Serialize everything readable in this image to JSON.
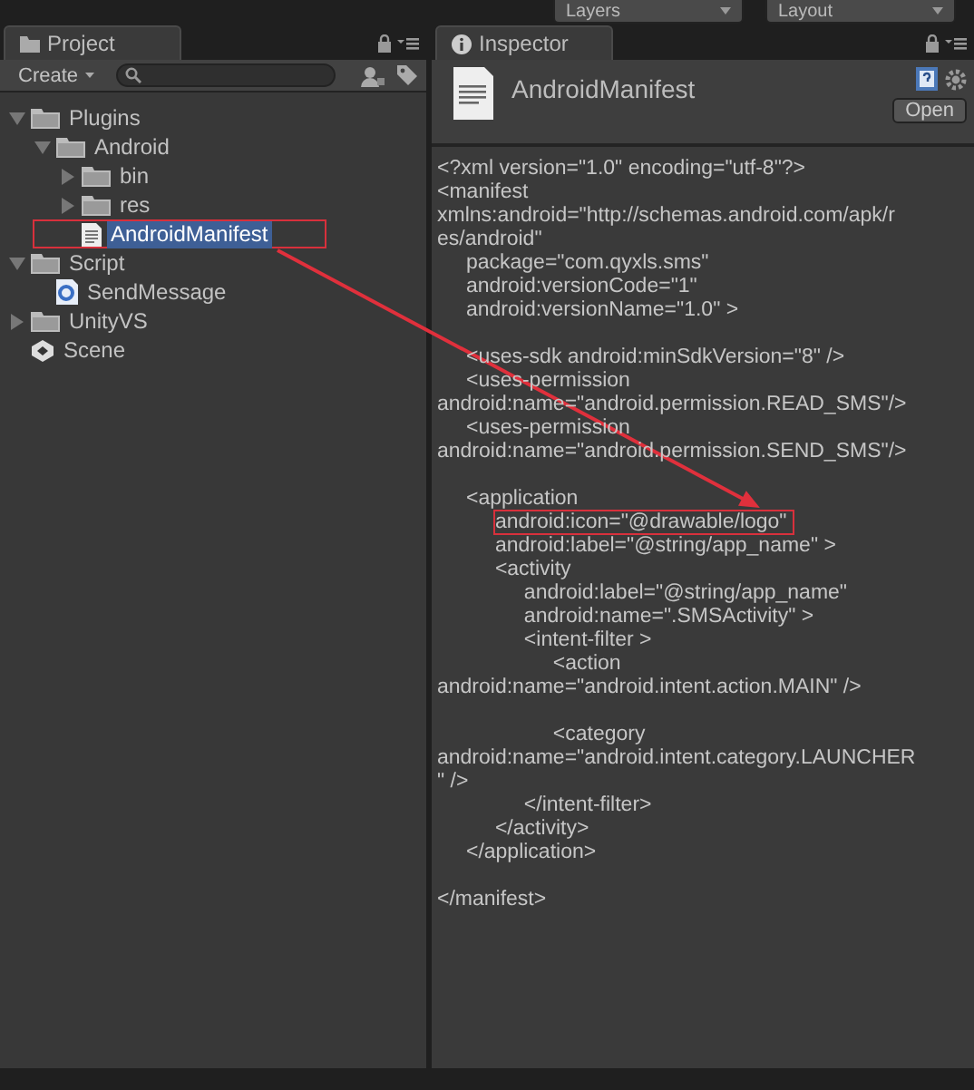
{
  "toolbar": {
    "dropdowns": [
      {
        "label": "Layers"
      },
      {
        "label": "Layout"
      }
    ]
  },
  "project": {
    "tab": "Project",
    "create_button": "Create",
    "tree": [
      {
        "label": "Plugins",
        "kind": "folder",
        "expanded": true,
        "selected": false,
        "boxed": false,
        "children": [
          {
            "label": "Android",
            "kind": "folder",
            "expanded": true,
            "selected": false,
            "boxed": false,
            "children": [
              {
                "label": "bin",
                "kind": "folder",
                "expanded": false,
                "selected": false,
                "boxed": false
              },
              {
                "label": "res",
                "kind": "folder",
                "expanded": false,
                "selected": false,
                "boxed": false
              },
              {
                "label": "AndroidManifest",
                "kind": "text-file",
                "selected": true,
                "boxed": true
              }
            ]
          }
        ]
      },
      {
        "label": "Script",
        "kind": "folder",
        "expanded": true,
        "selected": false,
        "boxed": false,
        "children": [
          {
            "label": "SendMessage",
            "kind": "script",
            "selected": false,
            "boxed": false
          }
        ]
      },
      {
        "label": "UnityVS",
        "kind": "folder",
        "expanded": false,
        "selected": false,
        "boxed": false
      },
      {
        "label": "Scene",
        "kind": "scene",
        "selected": false,
        "boxed": false
      }
    ]
  },
  "inspector": {
    "tab": "Inspector",
    "title": "AndroidManifest",
    "open_button": "Open",
    "blocks": [
      {
        "lines": [
          {
            "text": "<?xml version=\"1.0\" encoding=\"utf-8\"?>",
            "boxed": false
          },
          {
            "text": "<manifest",
            "boxed": false
          },
          {
            "text": "xmlns:android=\"http://schemas.android.com/apk/r",
            "boxed": false
          },
          {
            "text": "es/android\"",
            "boxed": false
          },
          {
            "text": "     package=\"com.qyxls.sms\"",
            "boxed": false
          },
          {
            "text": "     android:versionCode=\"1\"",
            "boxed": false
          },
          {
            "text": "     android:versionName=\"1.0\" >",
            "boxed": false
          }
        ]
      },
      {
        "lines": [
          {
            "text": "     <uses-sdk android:minSdkVersion=\"8\" />",
            "boxed": false
          },
          {
            "text": "     <uses-permission",
            "boxed": false
          },
          {
            "text": "android:name=\"android.permission.READ_SMS\"/>",
            "boxed": false
          },
          {
            "text": "     <uses-permission",
            "boxed": false
          },
          {
            "text": "android:name=\"android.permission.SEND_SMS\"/>",
            "boxed": false
          }
        ]
      },
      {
        "lines": [
          {
            "text": "     <application",
            "boxed": false
          },
          {
            "text": "          android:icon=\"@drawable/logo\"",
            "boxed": true
          },
          {
            "text": "          android:label=\"@string/app_name\" >",
            "boxed": false
          },
          {
            "text": "          <activity",
            "boxed": false
          },
          {
            "text": "               android:label=\"@string/app_name\"",
            "boxed": false
          },
          {
            "text": "               android:name=\".SMSActivity\" >",
            "boxed": false
          },
          {
            "text": "               <intent-filter >",
            "boxed": false
          },
          {
            "text": "                    <action",
            "boxed": false
          },
          {
            "text": "android:name=\"android.intent.action.MAIN\" />",
            "boxed": false
          }
        ]
      },
      {
        "lines": [
          {
            "text": "                    <category",
            "boxed": false
          },
          {
            "text": "android:name=\"android.intent.category.LAUNCHER",
            "boxed": false
          },
          {
            "text": "\" />",
            "boxed": false
          },
          {
            "text": "               </intent-filter>",
            "boxed": false
          },
          {
            "text": "          </activity>",
            "boxed": false
          },
          {
            "text": "     </application>",
            "boxed": false
          }
        ]
      },
      {
        "lines": [
          {
            "text": "</manifest>",
            "boxed": false
          }
        ]
      }
    ]
  },
  "annotation_arrow": true
}
